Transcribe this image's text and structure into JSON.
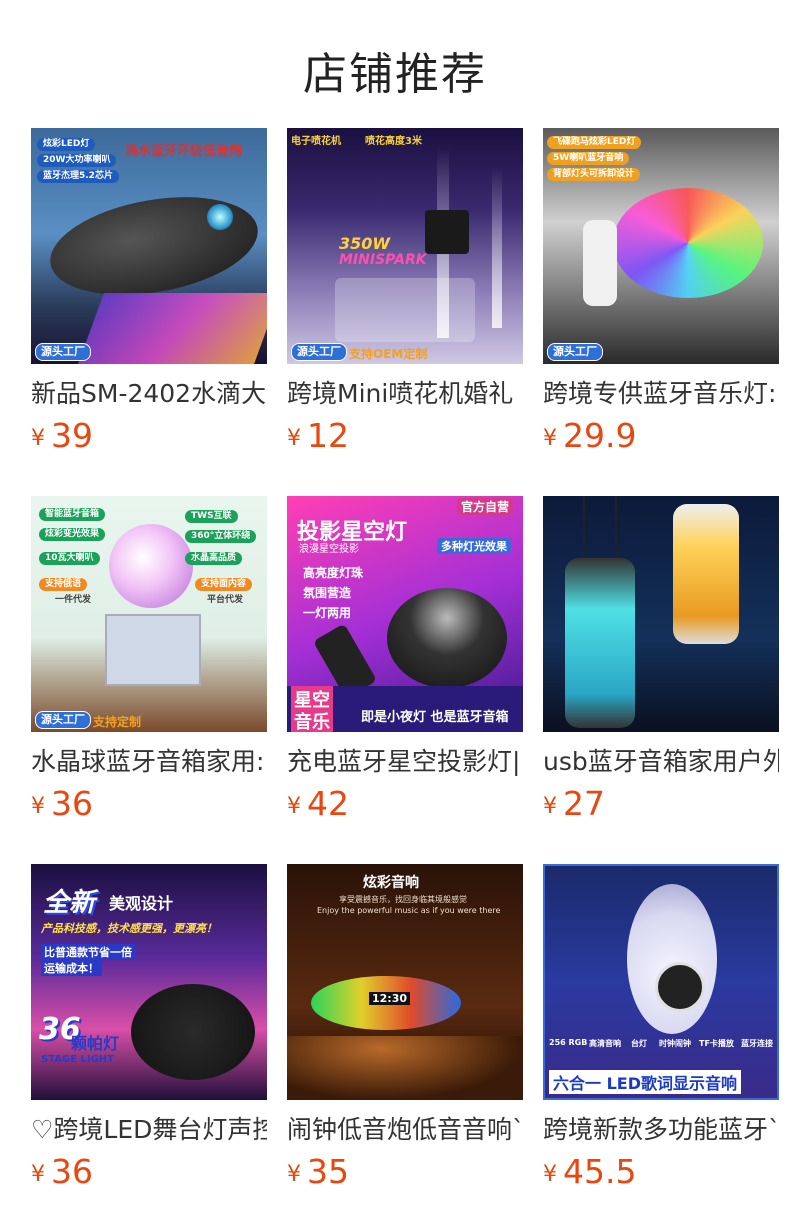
{
  "header": {
    "title": "店铺推荐"
  },
  "products": [
    {
      "name": "新品SM-2402水滴大",
      "currency": "¥",
      "price": "39",
      "image_text": [
        "炫彩LED灯",
        "20W大功率喇叭",
        "蓝牙杰理5.2芯片",
        "滴水蓝牙环绕低音炮"
      ],
      "badge": "源头工厂"
    },
    {
      "name": "跨境Mini喷花机婚礼",
      "currency": "¥",
      "price": "12",
      "image_text": [
        "电子喷花机",
        "喷花高度3米",
        "350W",
        "MINISPARK"
      ],
      "badge": "源头工厂",
      "badge2": "支持OEM定制"
    },
    {
      "name": "跨境专供蓝牙音乐灯:",
      "currency": "¥",
      "price": "29.9",
      "image_text": [
        "飞碟跑马炫彩LED灯",
        "5W喇叭蓝牙音响",
        "背部灯头可拆卸设计"
      ],
      "badge": "源头工厂"
    },
    {
      "name": "水晶球蓝牙音箱家用:",
      "currency": "¥",
      "price": "36",
      "image_text": [
        "智能蓝牙音箱",
        "炫彩变光效果",
        "10瓦大喇叭",
        "TWS互联",
        "360°立体环绕",
        "水晶高品质",
        "支持俄语",
        "一件代发",
        "支持面内容",
        "平台代发"
      ],
      "badge": "源头工厂",
      "badge2": "支持定制"
    },
    {
      "name": "充电蓝牙星空投影灯|",
      "currency": "¥",
      "price": "42",
      "image_text": [
        "官方自营",
        "投影星空灯",
        "浪漫星空投影",
        "多种灯光效果",
        "高亮度灯珠",
        "氛围营造",
        "一灯两用",
        "星空",
        "音乐",
        "即是小夜灯 也是蓝牙音箱"
      ]
    },
    {
      "name": "usb蓝牙音箱家用户外",
      "currency": "¥",
      "price": "27",
      "image_text": []
    },
    {
      "name": "♡跨境LED舞台灯声控",
      "currency": "¥",
      "price": "36",
      "image_text": [
        "全新",
        "美观设计",
        "产品科技感，技术感更强，更漂亮！",
        "比普通款节省一倍",
        "运输成本！",
        "36",
        "颗帕灯",
        "STAGE LIGHT"
      ]
    },
    {
      "name": "闹钟低音炮低音音响`",
      "currency": "¥",
      "price": "35",
      "image_text": [
        "炫彩音响",
        "享受震撼音乐，找回身临其境般感觉",
        "Enjoy the powerful music as if you were there",
        "12:30"
      ]
    },
    {
      "name": "跨境新款多功能蓝牙`",
      "currency": "¥",
      "price": "45.5",
      "image_text": [
        "256 RGB",
        "高清音响",
        "台灯",
        "时钟闹钟",
        "TF卡播放",
        "蓝牙连接",
        "六合一 LED歌词显示音响"
      ]
    }
  ],
  "colors": {
    "price": "#e8470f",
    "badge": "#2e6fd8"
  }
}
